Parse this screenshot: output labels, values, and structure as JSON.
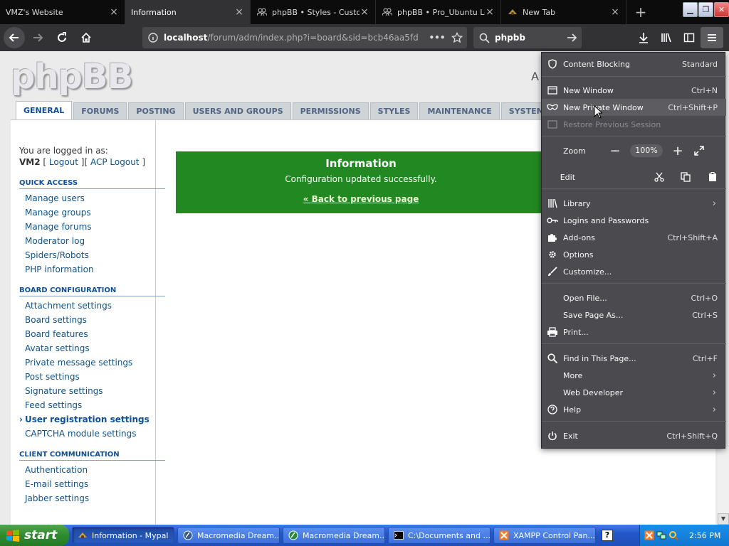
{
  "browser": {
    "tabs": [
      {
        "title": "VMZ's Website",
        "active": false
      },
      {
        "title": "Information",
        "active": true
      },
      {
        "title": "phpBB • Styles - Custo",
        "active": false
      },
      {
        "title": "phpBB • Pro_Ubuntu Lo",
        "active": false
      },
      {
        "title": "New Tab",
        "active": false
      }
    ],
    "new_tab_glyph": "+",
    "url_host": "localhost",
    "url_path": "/forum/adm/index.php?i=board&sid=bcb46aa5fd",
    "search_value": "phpbb"
  },
  "page": {
    "logo": "phpBB",
    "partial_header": "A",
    "tabs": [
      "GENERAL",
      "FORUMS",
      "POSTING",
      "USERS AND GROUPS",
      "PERMISSIONS",
      "STYLES",
      "MAINTENANCE",
      "SYSTEM"
    ],
    "login_text": "You are logged in as:",
    "username": "VM2",
    "logout": "Logout",
    "acp_logout": "ACP Logout",
    "sections": [
      {
        "title": "QUICK ACCESS",
        "links": [
          "Manage users",
          "Manage groups",
          "Manage forums",
          "Moderator log",
          "Spiders/Robots",
          "PHP information"
        ]
      },
      {
        "title": "BOARD CONFIGURATION",
        "links": [
          "Attachment settings",
          "Board settings",
          "Board features",
          "Avatar settings",
          "Private message settings",
          "Post settings",
          "Signature settings",
          "Feed settings",
          "User registration settings",
          "CAPTCHA module settings"
        ]
      },
      {
        "title": "CLIENT COMMUNICATION",
        "links": [
          "Authentication",
          "E-mail settings",
          "Jabber settings"
        ]
      }
    ],
    "current_link": "User registration settings",
    "message": {
      "title": "Information",
      "text": "Configuration updated successfully.",
      "back": "« Back to previous page"
    }
  },
  "menu": {
    "content_blocking": "Content Blocking",
    "content_blocking_value": "Standard",
    "new_window": "New Window",
    "new_window_sc": "Ctrl+N",
    "private_window": "New Private Window",
    "private_window_sc": "Ctrl+Shift+P",
    "restore": "Restore Previous Session",
    "zoom": "Zoom",
    "zoom_value": "100%",
    "edit": "Edit",
    "library": "Library",
    "logins": "Logins and Passwords",
    "addons": "Add-ons",
    "addons_sc": "Ctrl+Shift+A",
    "options": "Options",
    "customize": "Customize...",
    "open_file": "Open File...",
    "open_file_sc": "Ctrl+O",
    "save_page": "Save Page As...",
    "save_page_sc": "Ctrl+S",
    "print": "Print...",
    "find": "Find in This Page...",
    "find_sc": "Ctrl+F",
    "more": "More",
    "web_dev": "Web Developer",
    "help": "Help",
    "exit": "Exit",
    "exit_sc": "Ctrl+Shift+Q"
  },
  "taskbar": {
    "start": "start",
    "tasks": [
      "Information - Mypal",
      "Macromedia Dream...",
      "Macromedia Dream...",
      "C:\\Documents and ...",
      "XAMPP Control Pan..."
    ],
    "clock": "2:56 PM"
  }
}
